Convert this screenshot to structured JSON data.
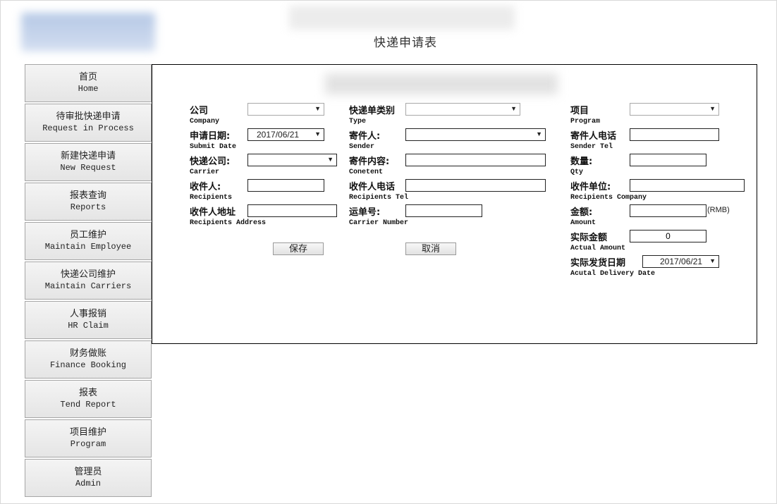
{
  "header": {
    "title": "快递申请表"
  },
  "sidebar": {
    "items": [
      {
        "cn": "首页",
        "en": "Home"
      },
      {
        "cn": "待审批快递申请",
        "en": "Request in Process"
      },
      {
        "cn": "新建快递申请",
        "en": "New Request"
      },
      {
        "cn": "报表查询",
        "en": "Reports"
      },
      {
        "cn": "员工维护",
        "en": "Maintain Employee"
      },
      {
        "cn": "快递公司维护",
        "en": "Maintain Carriers"
      },
      {
        "cn": "人事报销",
        "en": "HR Claim"
      },
      {
        "cn": "财务做账",
        "en": "Finance Booking"
      },
      {
        "cn": "报表",
        "en": "Tend Report"
      },
      {
        "cn": "项目维护",
        "en": "Program"
      },
      {
        "cn": "管理员",
        "en": "Admin"
      }
    ]
  },
  "form": {
    "company": {
      "cn": "公司",
      "en": "Company",
      "value": ""
    },
    "submit_date": {
      "cn": "申请日期:",
      "en": "Submit Date",
      "value": "2017/06/21"
    },
    "carrier": {
      "cn": "快递公司:",
      "en": "Carrier",
      "value": ""
    },
    "recipients": {
      "cn": "收件人:",
      "en": "Recipients",
      "value": ""
    },
    "recipients_address": {
      "cn": "收件人地址",
      "en": "Recipients Address",
      "value": ""
    },
    "type": {
      "cn": "快递单类别",
      "en": "Type",
      "value": ""
    },
    "sender": {
      "cn": "寄件人:",
      "en": "Sender",
      "value": ""
    },
    "content": {
      "cn": "寄件内容:",
      "en": "Conetent",
      "value": ""
    },
    "recipients_tel": {
      "cn": "收件人电话",
      "en": "Recipients Tel",
      "value": ""
    },
    "carrier_number": {
      "cn": "运单号:",
      "en": "Carrier Number",
      "value": ""
    },
    "program": {
      "cn": "项目",
      "en": "Program",
      "value": ""
    },
    "sender_tel": {
      "cn": "寄件人电话",
      "en": "Sender Tel",
      "value": ""
    },
    "qty": {
      "cn": "数量:",
      "en": "Qty",
      "value": ""
    },
    "recipients_company": {
      "cn": "收件单位:",
      "en": "Recipients Company",
      "value": ""
    },
    "amount": {
      "cn": "金额:",
      "en": "Amount",
      "value": "",
      "unit": "(RMB)"
    },
    "actual_amount": {
      "cn": "实际金额",
      "en": "Actual Amount",
      "value": "0"
    },
    "actual_delivery_date": {
      "cn": "实际发货日期",
      "en": "Acutal Delivery Date",
      "value": "2017/06/21"
    },
    "arrow": "▼",
    "save_label": "保存",
    "cancel_label": "取消"
  }
}
